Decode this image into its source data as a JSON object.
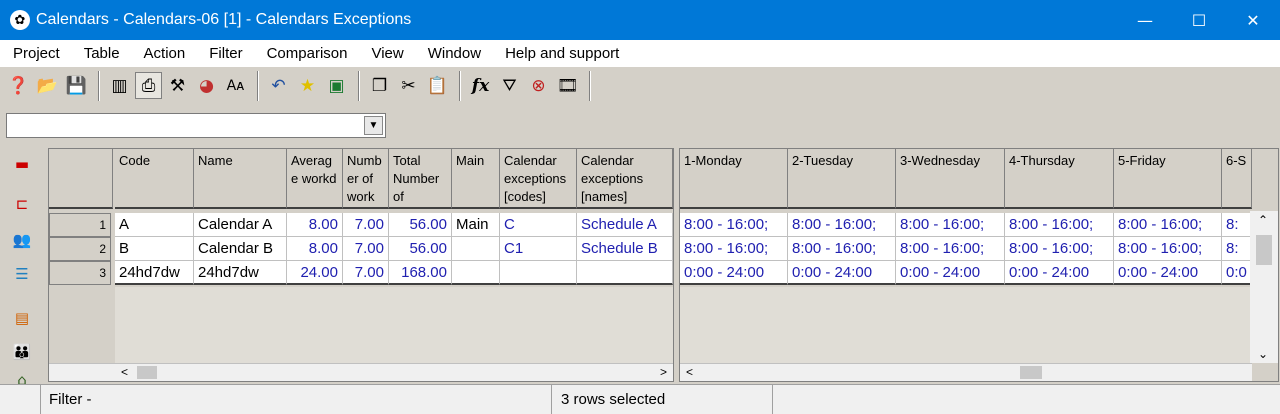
{
  "window": {
    "title": "Calendars - Calendars-06 [1] - Calendars Exceptions"
  },
  "menu": [
    "Project",
    "Table",
    "Action",
    "Filter",
    "Comparison",
    "View",
    "Window",
    "Help and support"
  ],
  "toolbar": {
    "icons": [
      "help-icon",
      "open-folder-icon",
      "save-icon",
      "columns-icon",
      "print-icon",
      "tools-icon",
      "chart-pie-icon",
      "font-icon",
      "undo-icon",
      "star-icon",
      "excel-icon",
      "copy-icon",
      "cut-icon",
      "paste-icon",
      "function-icon",
      "filter-icon",
      "clear-filter-icon",
      "film-icon"
    ]
  },
  "filter_combo": {
    "value": ""
  },
  "left_grid": {
    "columns": [
      {
        "label": "Code"
      },
      {
        "label": "Name"
      },
      {
        "label": "Averag\ne workd"
      },
      {
        "label": "Numb\ner of\nwork"
      },
      {
        "label": "Total\nNumber\nof"
      },
      {
        "label": "Main"
      },
      {
        "label": "Calendar\nexceptions\n[codes]"
      },
      {
        "label": "Calendar\nexceptions\n[names]"
      }
    ],
    "rows": [
      {
        "num": "1",
        "cells": [
          "A",
          "Calendar A",
          "8.00",
          "7.00",
          "56.00",
          "Main",
          "C",
          "Schedule A"
        ]
      },
      {
        "num": "2",
        "cells": [
          "B",
          "Calendar B",
          "8.00",
          "7.00",
          "56.00",
          "",
          "C1",
          "Schedule B"
        ]
      },
      {
        "num": "3",
        "cells": [
          "24hd7dw",
          "24hd7dw",
          "24.00",
          "7.00",
          "168.00",
          "",
          "",
          ""
        ]
      }
    ]
  },
  "right_grid": {
    "columns": [
      {
        "label": "1-Monday"
      },
      {
        "label": "2-Tuesday"
      },
      {
        "label": "3-Wednesday"
      },
      {
        "label": "4-Thursday"
      },
      {
        "label": "5-Friday"
      },
      {
        "label": "6-S"
      }
    ],
    "rows": [
      {
        "cells": [
          "8:00 - 16:00;",
          "8:00 - 16:00;",
          "8:00 - 16:00;",
          "8:00 - 16:00;",
          "8:00 - 16:00;",
          "8:"
        ]
      },
      {
        "cells": [
          "8:00 - 16:00;",
          "8:00 - 16:00;",
          "8:00 - 16:00;",
          "8:00 - 16:00;",
          "8:00 - 16:00;",
          "8:"
        ]
      },
      {
        "cells": [
          "0:00 - 24:00",
          "0:00 - 24:00",
          "0:00 - 24:00",
          "0:00 - 24:00",
          "0:00 - 24:00",
          "0:0"
        ]
      }
    ]
  },
  "status": {
    "filter": "Filter -",
    "selection": "3 rows selected"
  }
}
